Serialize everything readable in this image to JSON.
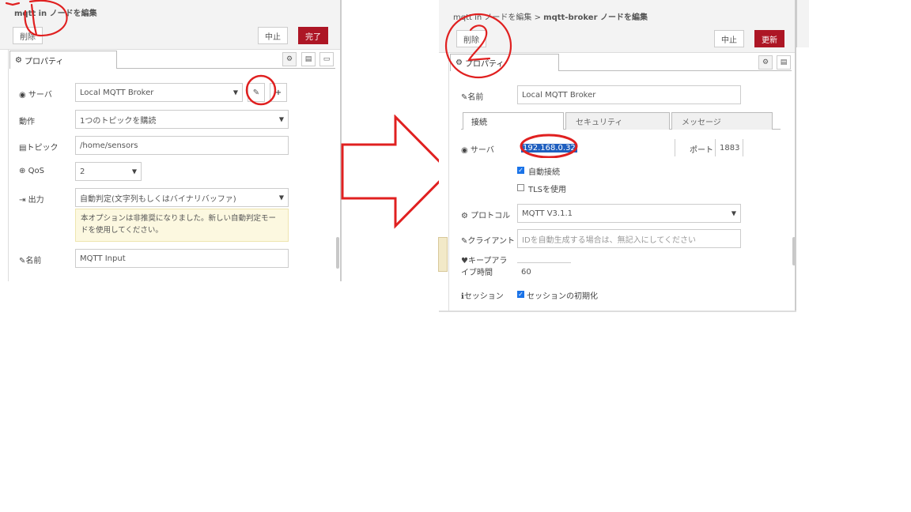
{
  "left_panel": {
    "header_title": "mqtt in ノードを編集",
    "delete_button": "削除",
    "cancel_button": "中止",
    "done_button": "完了",
    "properties_tab": "プロパティ",
    "fields": {
      "server_label": "サーバ",
      "server_value": "Local MQTT Broker",
      "action_label": "動作",
      "action_value": "1つのトピックを購読",
      "topic_label": "トピック",
      "topic_value": "/home/sensors",
      "qos_label": "QoS",
      "qos_value": "2",
      "output_label": "出力",
      "output_value": "自動判定(文字列もしくはバイナリバッファ)",
      "deprecation_note": "本オプションは非推奨になりました。新しい自動判定モードを使用してください。",
      "name_label": "名前",
      "name_value": "MQTT Input"
    },
    "annotation": "1"
  },
  "arrow": {
    "color": "#e02020"
  },
  "right_panel": {
    "breadcrumb_first": "mqtt in ノードを編集 >",
    "breadcrumb_second": "mqtt-broker ノードを編集",
    "delete_button": "削除",
    "cancel_button": "中止",
    "update_button": "更新",
    "properties_tab": "プロパティ",
    "fields": {
      "name_label": "名前",
      "name_value": "Local MQTT Broker",
      "sub_tabs": [
        "接続",
        "セキュリティ",
        "メッセージ"
      ],
      "server_label": "サーバ",
      "server_value": "192.168.0.32",
      "port_label": "ポート",
      "port_value": "1883",
      "auto_connect_label": "自動接続",
      "auto_connect_checked": true,
      "tls_label": "TLSを使用",
      "tls_checked": false,
      "protocol_label": "プロトコル",
      "protocol_value": "MQTT V3.1.1",
      "client_label": "クライアント",
      "client_placeholder": "IDを自動生成する場合は、無記入にしてください",
      "keepalive_label": "キープアライブ時間",
      "keepalive_value": "60",
      "session_label": "セッション",
      "session_option": "セッションの初期化",
      "session_checked": true
    },
    "annotation": "2"
  },
  "colors": {
    "accent": "#ad1625",
    "annotation": "#e02020",
    "checkbox": "#1a73e8"
  }
}
